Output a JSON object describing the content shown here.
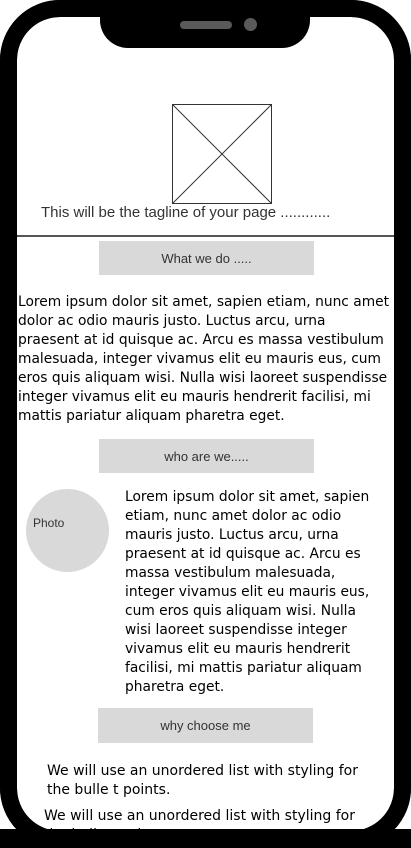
{
  "header": {
    "image_placeholder_icon": "image-placeholder-icon",
    "tagline": "This will be the tagline of your page ............"
  },
  "sections": {
    "what": {
      "button_label": "What we do .....",
      "text": "Lorem ipsum dolor sit amet, sapien etiam, nunc amet dolor ac odio mauris justo. Luctus arcu, urna praesent at id quisque ac. Arcu es massa vestibulum malesuada, integer vivamus elit eu mauris eus, cum eros quis aliquam wisi. Nulla wisi laoreet suspendisse integer vivamus elit eu mauris hendrerit facilisi, mi mattis pariatur aliquam pharetra eget."
    },
    "who": {
      "button_label": "who are we.....",
      "photo_label": "Photo",
      "text": "Lorem ipsum dolor sit amet, sapien etiam, nunc amet dolor ac odio mauris justo. Luctus arcu, urna praesent at id quisque ac. Arcu es massa vestibulum malesuada, integer vivamus elit eu mauris eus, cum eros quis aliquam wisi. Nulla wisi laoreet suspendisse integer vivamus elit eu mauris hendrerit facilisi, mi mattis pariatur aliquam pharetra eget."
    },
    "why": {
      "button_label": "why choose me",
      "list_text_1": "We will use an unordered list with styling for the bulle t points.",
      "list_text_2": "We will use an unordered list with styling for the bulle t points."
    }
  },
  "colors": {
    "frame": "#000000",
    "button_bg": "#d9d9d9",
    "photo_bg": "#d9d9d9",
    "divider": "#555555"
  }
}
